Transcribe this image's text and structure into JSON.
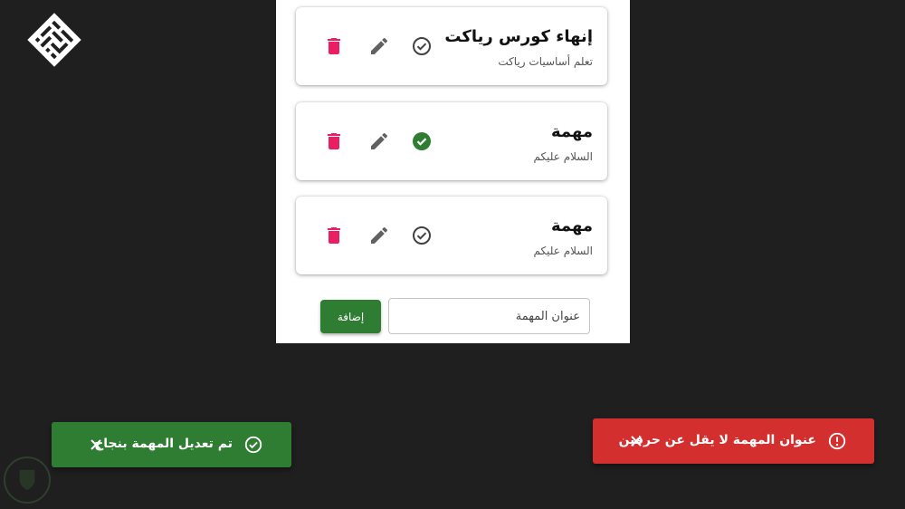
{
  "colors": {
    "background": "#1f1f1f",
    "panel": "#ffffff",
    "success": "#2e7d32",
    "error": "#d32f2f",
    "delete_icon": "#e91e63",
    "edit_icon": "#616161",
    "check_icon": "#424242"
  },
  "logo": {
    "icon": "kufic-logo-icon"
  },
  "todos": [
    {
      "title": "إنهاء كورس رياكت",
      "details": "تعلم أساسيات رياكت",
      "done": false
    },
    {
      "title": "مهمة",
      "details": "السلام عليكم",
      "done": true
    },
    {
      "title": "مهمة",
      "details": "السلام عليكم",
      "done": false
    }
  ],
  "form": {
    "input_placeholder": "عنوان المهمة",
    "add_label": "إضافة"
  },
  "toasts": {
    "success": {
      "message": "تم تعديل المهمة بنجاح",
      "icon": "check-circle-icon"
    },
    "error": {
      "message": "عنوان المهمة لا يقل عن حرفين",
      "icon": "error-outline-icon"
    }
  }
}
